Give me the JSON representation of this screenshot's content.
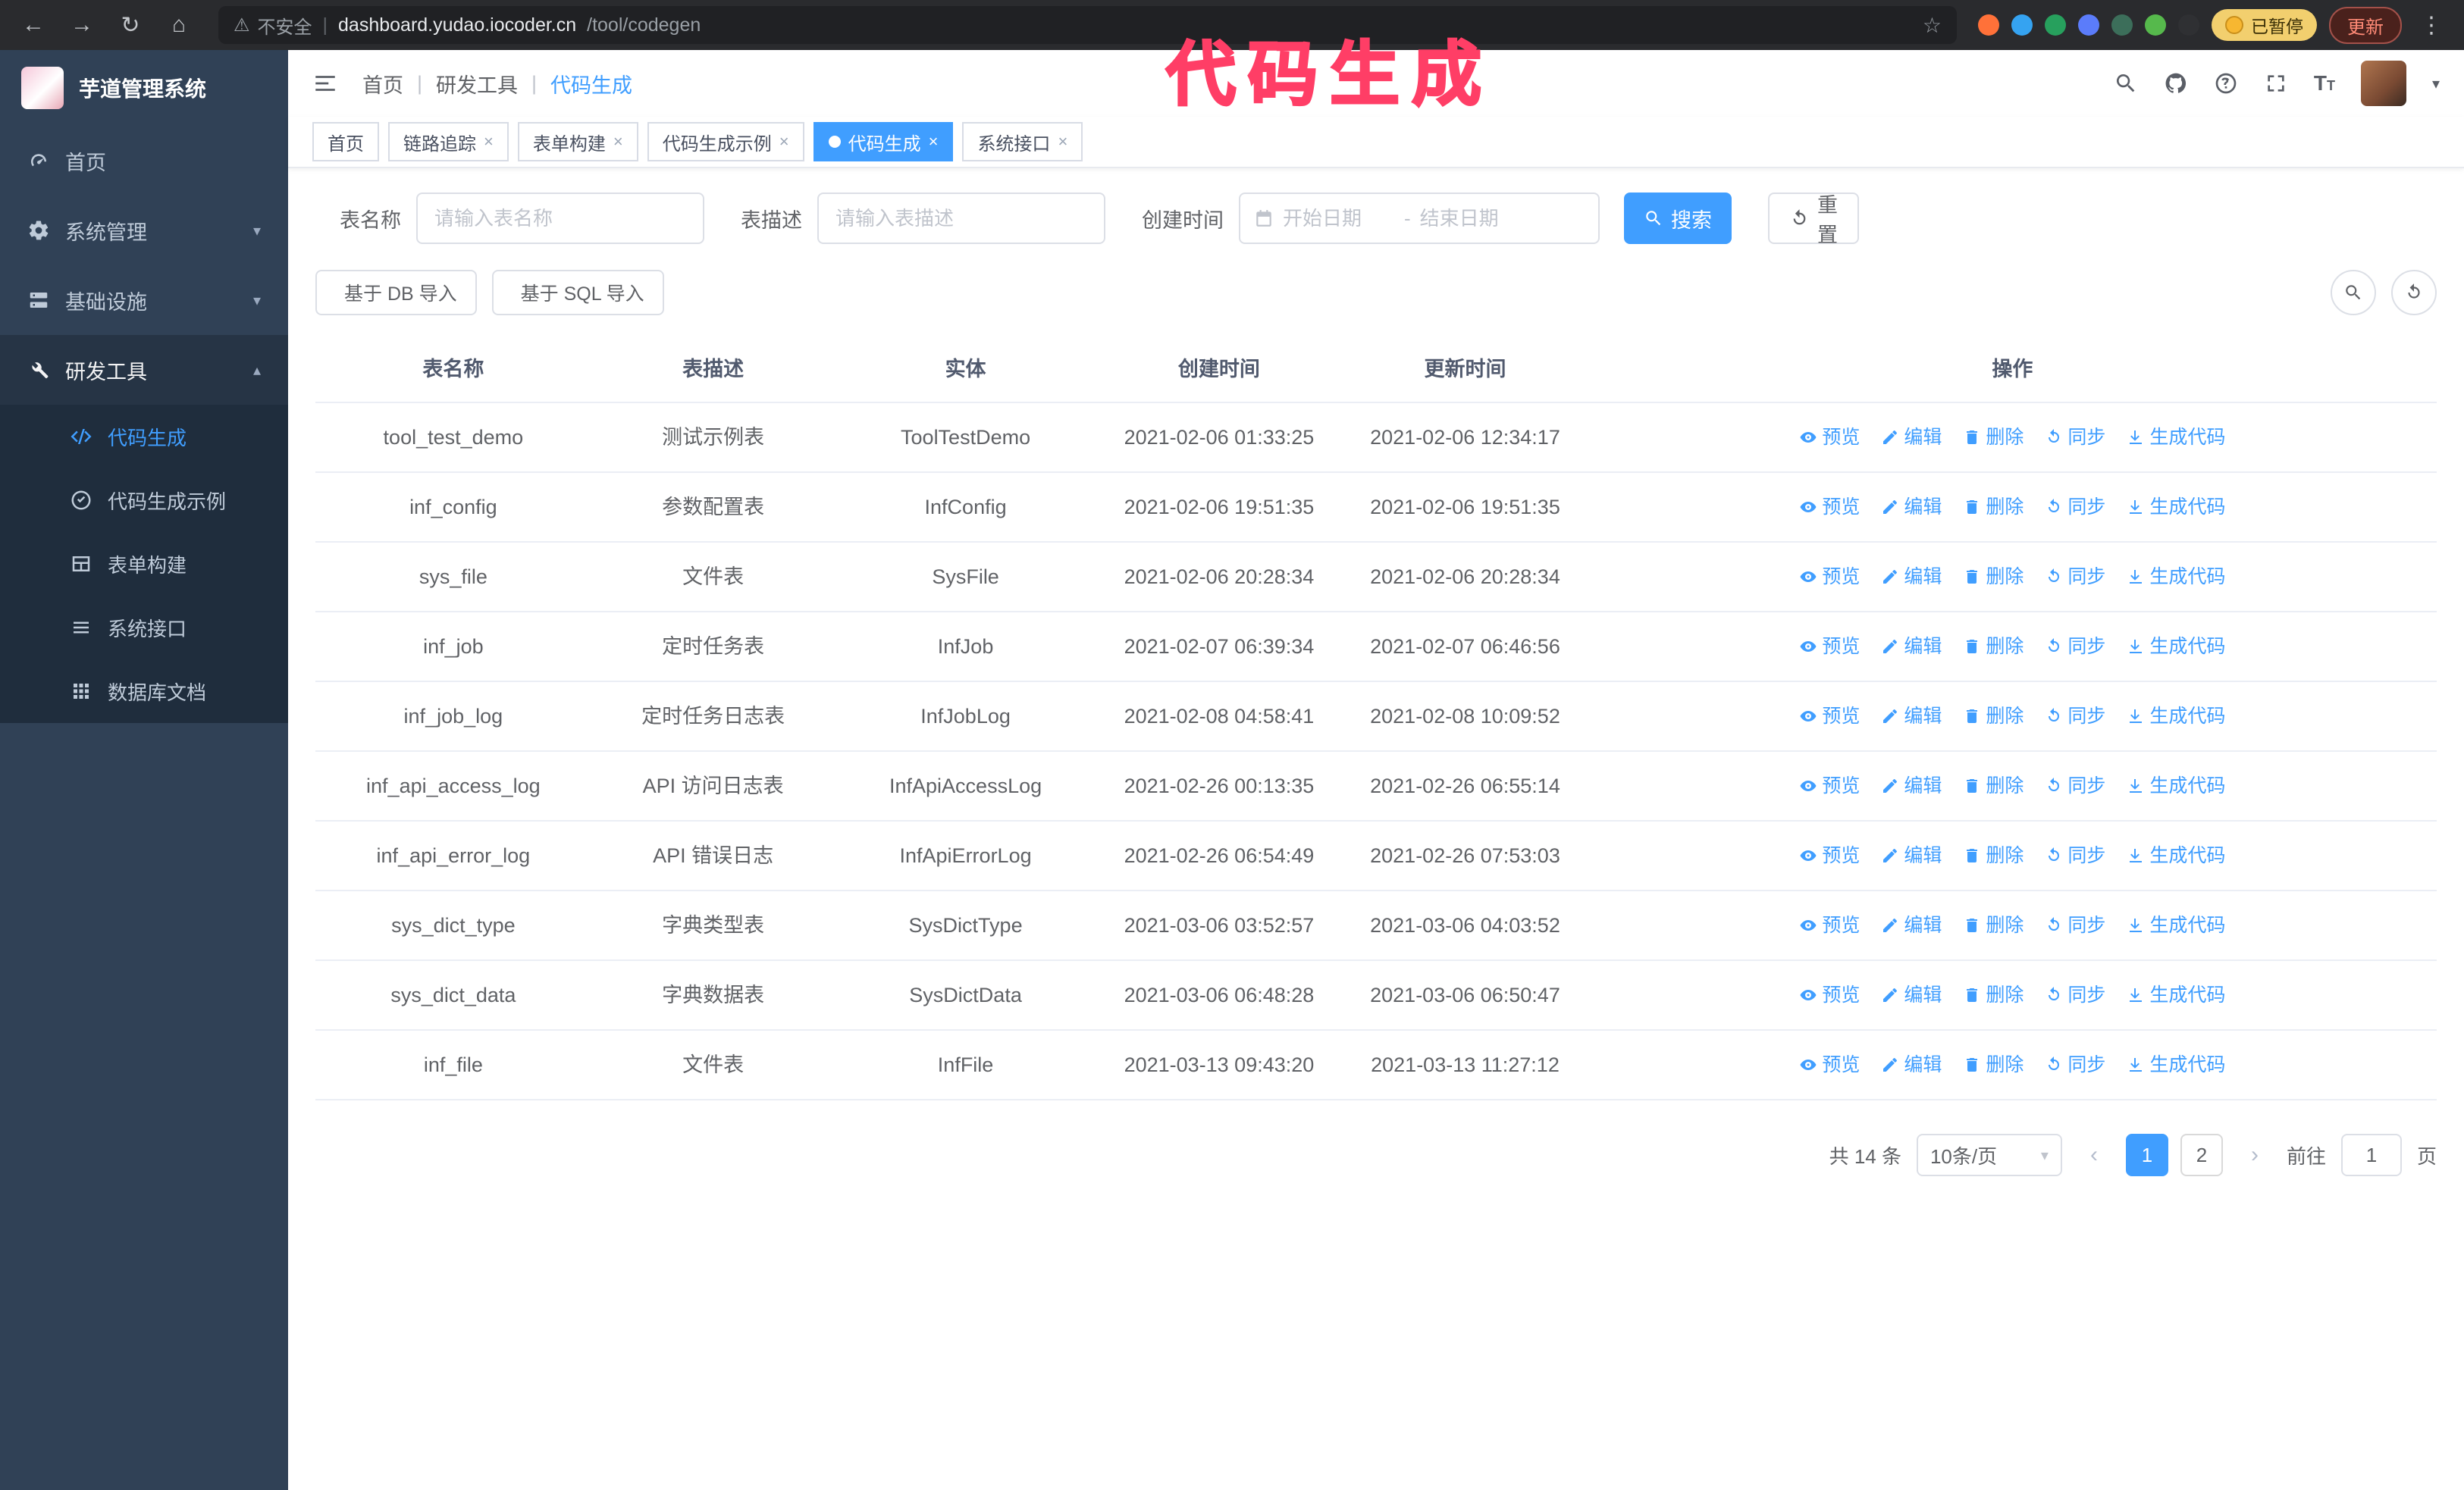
{
  "annotation": {
    "text": "代码生成",
    "color": "#ff3e66"
  },
  "ui": {
    "back": "←",
    "forward": "→",
    "reload": "↻",
    "home": "⌂",
    "warning": "⚠",
    "divider": "|",
    "star": "☆",
    "kebab": "⋮",
    "close_symbol": "×",
    "chevron_down": "▾",
    "chevron_up": "▴",
    "dropdown_caret": "▾",
    "page_prev": "‹",
    "page_next": "›"
  },
  "browser": {
    "security_warning": "不安全",
    "url_domain": "dashboard.yudao.iocoder.cn",
    "url_path": "/tool/codegen",
    "extension_colors": [
      "#ff7139",
      "#35a3f1",
      "#27a05d",
      "#5b7cfa",
      "#3c6e5a",
      "#56b94c",
      "#2f3033"
    ],
    "paused_badge": "已暂停",
    "update_button": "更新"
  },
  "sidebar": {
    "app_title": "芋道管理系统",
    "items": [
      {
        "label": "首页",
        "icon": "dashboard-icon",
        "expandable": false,
        "expanded": false
      },
      {
        "label": "系统管理",
        "icon": "gear-icon",
        "expandable": true,
        "expanded": false
      },
      {
        "label": "基础设施",
        "icon": "server-icon",
        "expandable": true,
        "expanded": false
      },
      {
        "label": "研发工具",
        "icon": "tools-icon",
        "expandable": true,
        "expanded": true
      }
    ],
    "submenu": [
      {
        "label": "代码生成",
        "icon": "code-icon",
        "active": true
      },
      {
        "label": "代码生成示例",
        "icon": "badge-icon",
        "active": false
      },
      {
        "label": "表单构建",
        "icon": "form-icon",
        "active": false
      },
      {
        "label": "系统接口",
        "icon": "api-icon",
        "active": false
      },
      {
        "label": "数据库文档",
        "icon": "db-icon",
        "active": false
      }
    ]
  },
  "navbar": {
    "breadcrumb": [
      "首页",
      "研发工具",
      "代码生成"
    ]
  },
  "tabs": [
    {
      "label": "首页",
      "closable": false,
      "active": false
    },
    {
      "label": "链路追踪",
      "closable": true,
      "active": false
    },
    {
      "label": "表单构建",
      "closable": true,
      "active": false
    },
    {
      "label": "代码生成示例",
      "closable": true,
      "active": false
    },
    {
      "label": "代码生成",
      "closable": true,
      "active": true
    },
    {
      "label": "系统接口",
      "closable": true,
      "active": false
    }
  ],
  "filters": {
    "table_name_label": "表名称",
    "table_name_placeholder": "请输入表名称",
    "table_desc_label": "表描述",
    "table_desc_placeholder": "请输入表描述",
    "create_time_label": "创建时间",
    "date_start_placeholder": "开始日期",
    "date_separator": "-",
    "date_end_placeholder": "结束日期",
    "search_button": "搜索",
    "reset_button": "重置"
  },
  "toolbar": {
    "import_db_button": "基于 DB 导入",
    "import_sql_button": "基于 SQL 导入"
  },
  "table": {
    "columns": [
      "表名称",
      "表描述",
      "实体",
      "创建时间",
      "更新时间",
      "操作"
    ],
    "actions": [
      "预览",
      "编辑",
      "删除",
      "同步",
      "生成代码"
    ],
    "rows": [
      [
        "tool_test_demo",
        "测试示例表",
        "ToolTestDemo",
        "2021-02-06 01:33:25",
        "2021-02-06 12:34:17"
      ],
      [
        "inf_config",
        "参数配置表",
        "InfConfig",
        "2021-02-06 19:51:35",
        "2021-02-06 19:51:35"
      ],
      [
        "sys_file",
        "文件表",
        "SysFile",
        "2021-02-06 20:28:34",
        "2021-02-06 20:28:34"
      ],
      [
        "inf_job",
        "定时任务表",
        "InfJob",
        "2021-02-07 06:39:34",
        "2021-02-07 06:46:56"
      ],
      [
        "inf_job_log",
        "定时任务日志表",
        "InfJobLog",
        "2021-02-08 04:58:41",
        "2021-02-08 10:09:52"
      ],
      [
        "inf_api_access_log",
        "API 访问日志表",
        "InfApiAccessLog",
        "2021-02-26 00:13:35",
        "2021-02-26 06:55:14"
      ],
      [
        "inf_api_error_log",
        "API 错误日志",
        "InfApiErrorLog",
        "2021-02-26 06:54:49",
        "2021-02-26 07:53:03"
      ],
      [
        "sys_dict_type",
        "字典类型表",
        "SysDictType",
        "2021-03-06 03:52:57",
        "2021-03-06 04:03:52"
      ],
      [
        "sys_dict_data",
        "字典数据表",
        "SysDictData",
        "2021-03-06 06:48:28",
        "2021-03-06 06:50:47"
      ],
      [
        "inf_file",
        "文件表",
        "InfFile",
        "2021-03-13 09:43:20",
        "2021-03-13 11:27:12"
      ]
    ]
  },
  "pagination": {
    "total_text": "共 14 条",
    "page_size_value": "10条/页",
    "pages": [
      "1",
      "2"
    ],
    "active_page": "1",
    "goto_label": "前往",
    "goto_value": "1",
    "goto_suffix": "页"
  }
}
